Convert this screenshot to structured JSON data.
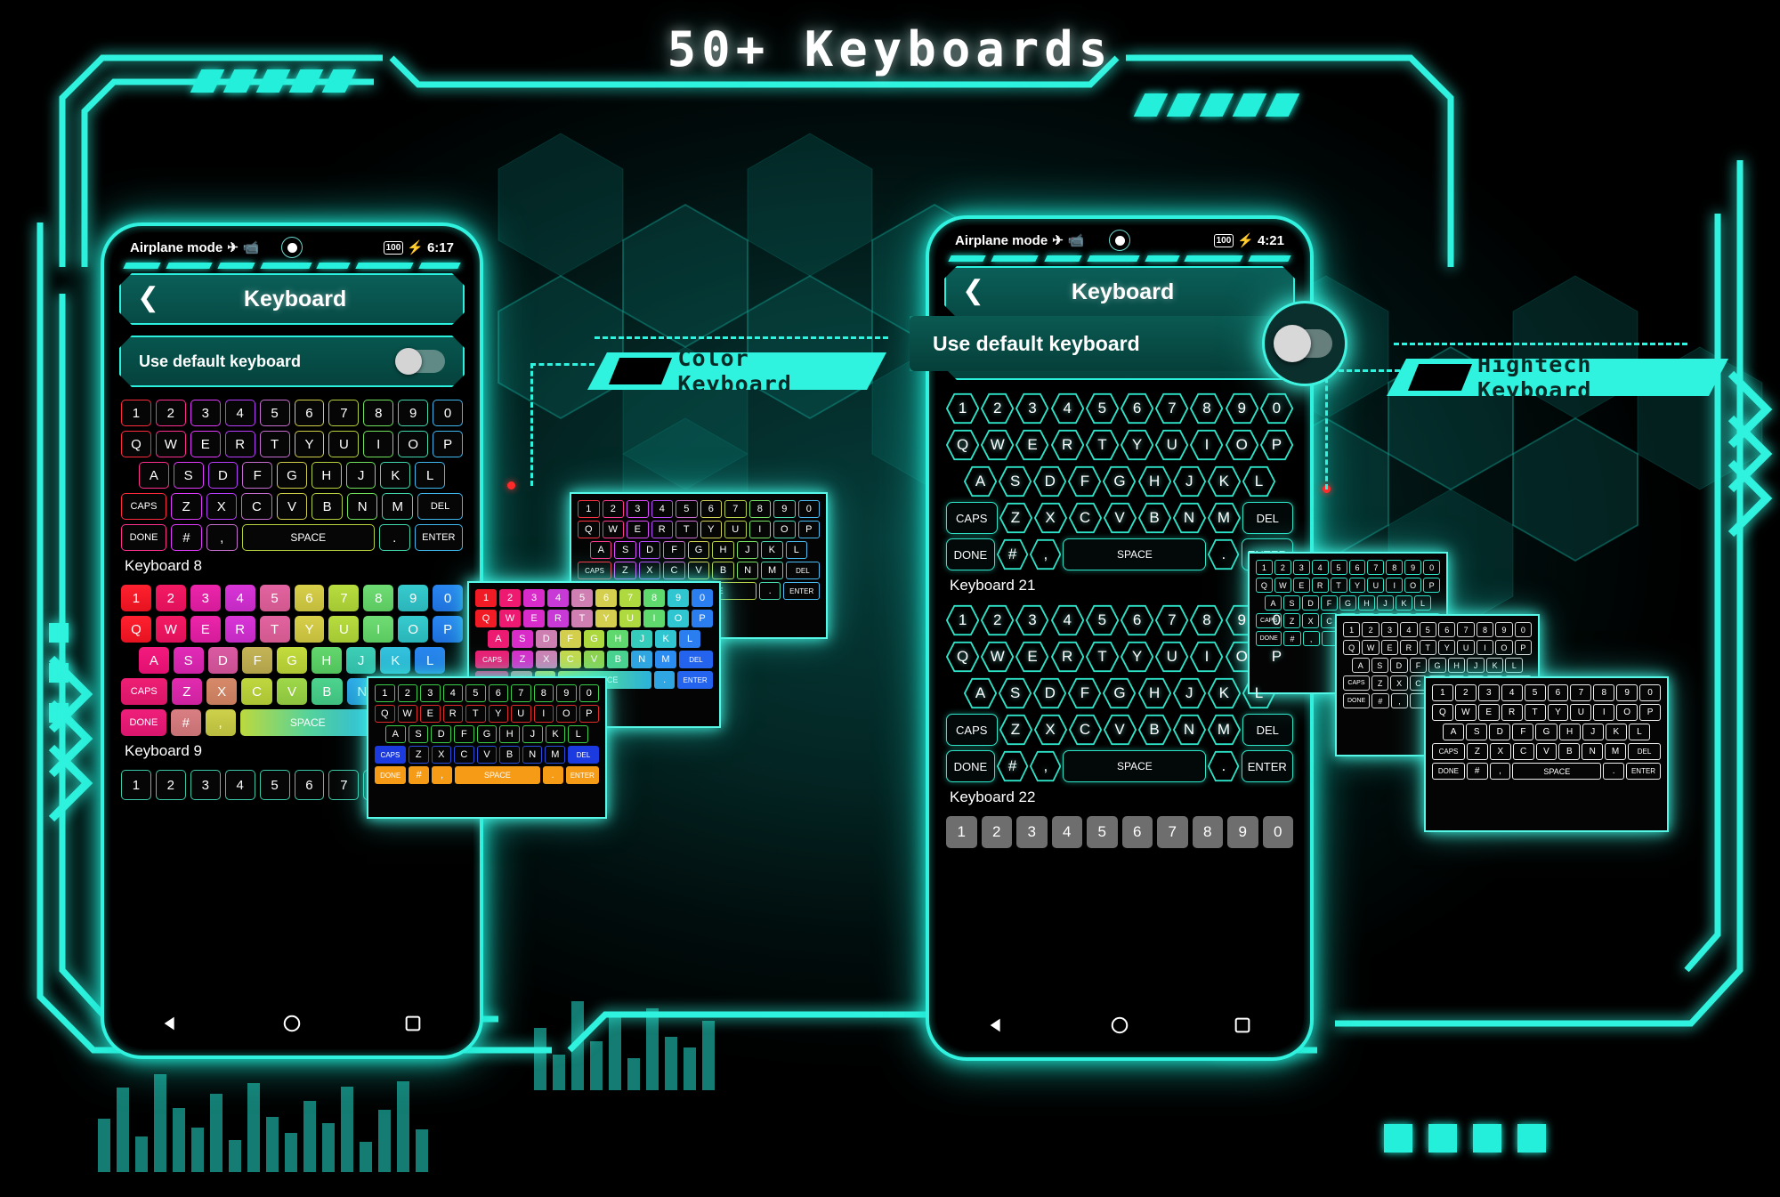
{
  "page": {
    "title": "50+ Keyboards",
    "accent": "#2ff3de",
    "bg": "#021a19"
  },
  "callouts": [
    {
      "label": "Color Keyboard"
    },
    {
      "label": "Hightech Keyboard"
    }
  ],
  "phones": [
    {
      "id": "left-phone",
      "status": {
        "airplane_text": "Airplane mode",
        "battery": "100",
        "time": "6:17"
      },
      "appbar": {
        "back_icon": "chevron-left-icon",
        "title": "Keyboard"
      },
      "default_row": {
        "label": "Use default keyboard",
        "toggle_state": "off"
      },
      "sections": [
        {
          "label": "Keyboard 8",
          "style": "neon"
        },
        {
          "label": "Keyboard 9",
          "style": "rainbow"
        }
      ],
      "nav": {
        "back": "triangle-back-icon",
        "home": "circle-home-icon",
        "recents": "square-recents-icon"
      }
    },
    {
      "id": "right-phone",
      "status": {
        "airplane_text": "Airplane mode",
        "battery": "100",
        "time": "4:21"
      },
      "appbar": {
        "back_icon": "chevron-left-icon",
        "title": "Keyboard"
      },
      "default_row": {
        "label": "Use default keyboard",
        "toggle_state": "off"
      },
      "sections": [
        {
          "label": "Keyboard 21",
          "style": "hex"
        },
        {
          "label": "Keyboard 22",
          "style": "hex"
        }
      ],
      "nav": {
        "back": "triangle-back-icon",
        "home": "circle-home-icon",
        "recents": "square-recents-icon"
      }
    }
  ],
  "magnified_row": {
    "label": "Use default keyboard",
    "toggle_state": "off"
  },
  "keyboard_layout": {
    "rows": [
      [
        "1",
        "2",
        "3",
        "4",
        "5",
        "6",
        "7",
        "8",
        "9",
        "0"
      ],
      [
        "Q",
        "W",
        "E",
        "R",
        "T",
        "Y",
        "U",
        "I",
        "O",
        "P"
      ],
      [
        "A",
        "S",
        "D",
        "F",
        "G",
        "H",
        "J",
        "K",
        "L"
      ],
      [
        "CAPS",
        "Z",
        "X",
        "C",
        "V",
        "B",
        "N",
        "M",
        "DEL"
      ],
      [
        "DONE",
        "#",
        ",",
        "SPACE",
        ".",
        "ENTER"
      ]
    ]
  },
  "key_colors_neon": [
    "#ff2b3c",
    "#ff2f8e",
    "#e23bff",
    "#b93cff",
    "#d04fd9",
    "#c9c943",
    "#bccf3c",
    "#7fe04a",
    "#43dba0",
    "#3fb9f0"
  ],
  "key_colors_rainbow": [
    "#f21a26",
    "#f21a6e",
    "#ea22b5",
    "#cf2fd6",
    "#e257a0",
    "#d7d23c",
    "#aee03a",
    "#62dd7e",
    "#2fc8d8",
    "#2a7df0"
  ],
  "floating_cards": [
    {
      "name": "mini-card-a",
      "style": "neon-small"
    },
    {
      "name": "mini-card-b",
      "style": "rainbow-small"
    },
    {
      "name": "mini-card-c",
      "style": "vivid-small"
    },
    {
      "name": "mini-card-d",
      "style": "hex-small-1"
    },
    {
      "name": "mini-card-e",
      "style": "hex-small-2"
    },
    {
      "name": "mini-card-f",
      "style": "hex-small-3"
    },
    {
      "name": "mini-card-g",
      "style": "hex-small-4"
    }
  ]
}
